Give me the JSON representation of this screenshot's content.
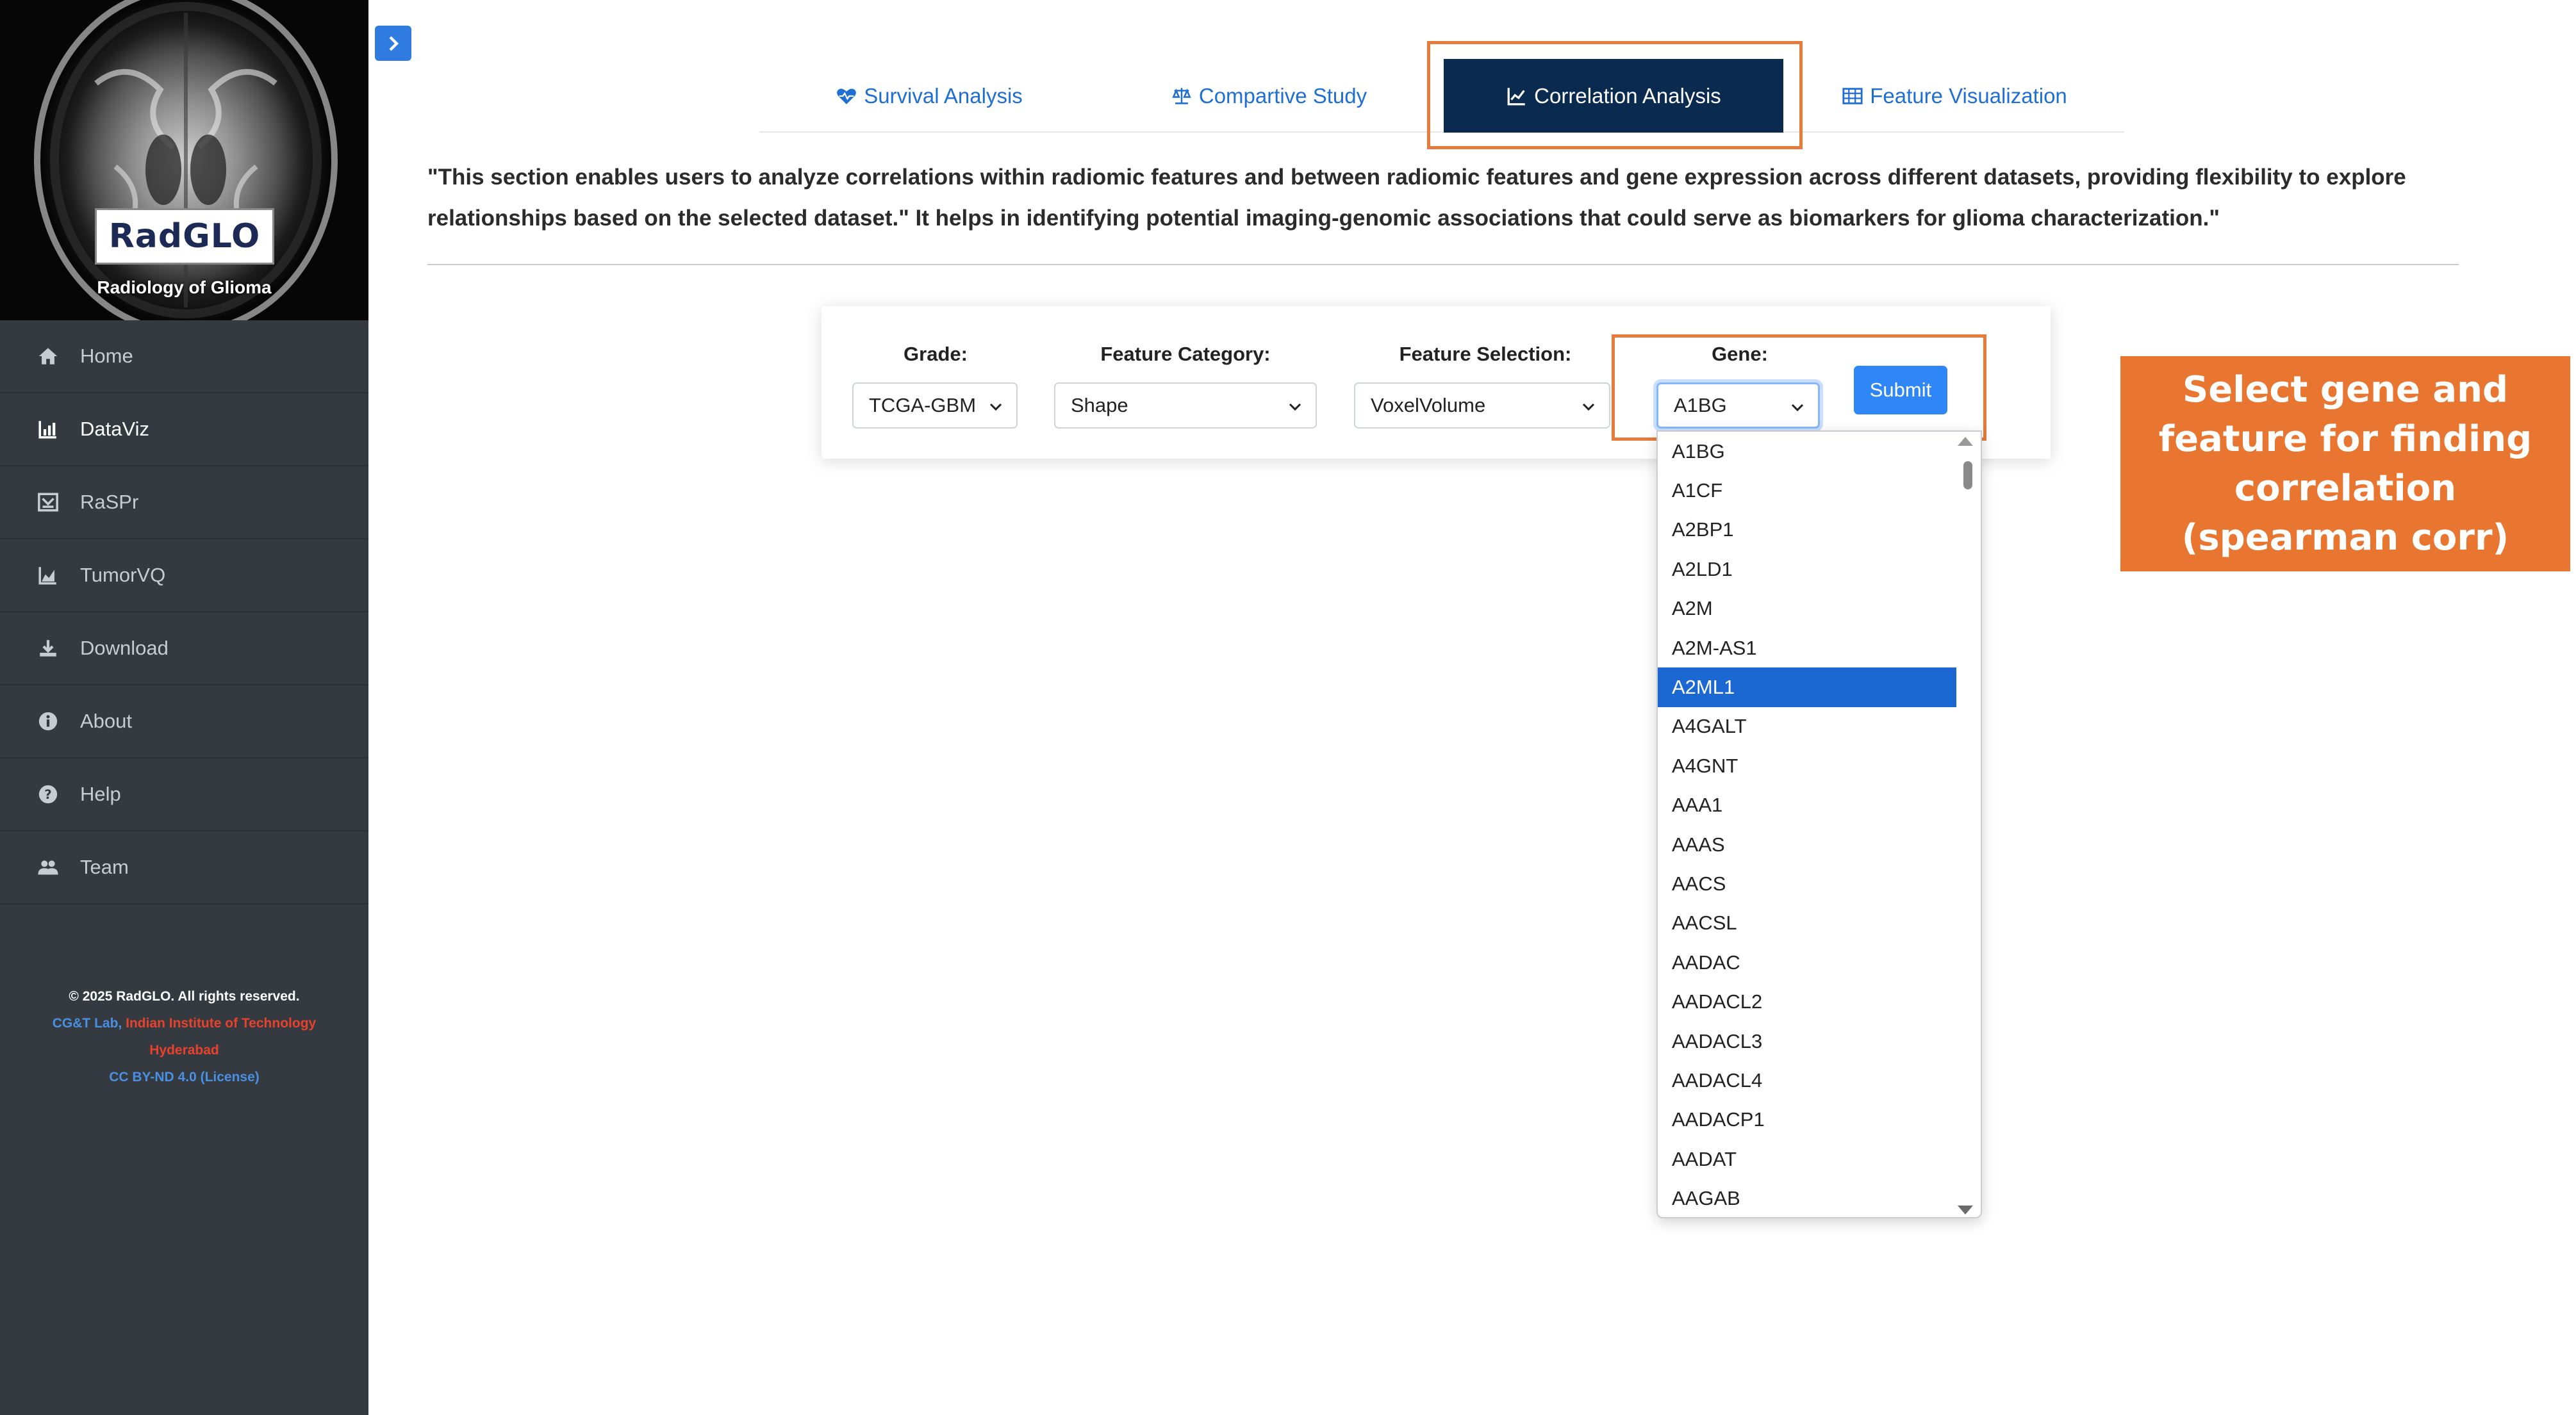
{
  "brand": {
    "title": "RadGLO",
    "subtitle": "Radiology of Glioma"
  },
  "sidebar": {
    "items": [
      {
        "label": "Home",
        "icon": "home-icon",
        "active": false
      },
      {
        "label": "DataViz",
        "icon": "bar-chart-icon",
        "active": true
      },
      {
        "label": "RaSPr",
        "icon": "network-icon",
        "active": false
      },
      {
        "label": "TumorVQ",
        "icon": "area-chart-icon",
        "active": false
      },
      {
        "label": "Download",
        "icon": "download-icon",
        "active": false
      },
      {
        "label": "About",
        "icon": "info-icon",
        "active": false
      },
      {
        "label": "Help",
        "icon": "question-icon",
        "active": false
      },
      {
        "label": "Team",
        "icon": "users-icon",
        "active": false
      }
    ],
    "footer": {
      "copyright": "© 2025 RadGLO. All rights reserved.",
      "lab": "CG&T Lab,",
      "institute_line1": "Indian Institute of Technology",
      "institute_line2": "Hyderabad",
      "license": "CC BY-ND 4.0 (License)"
    }
  },
  "tabs": [
    {
      "label": "Survival Analysis",
      "icon": "heartbeat-icon",
      "active": false
    },
    {
      "label": "Compartive Study",
      "icon": "balance-scale-icon",
      "active": false
    },
    {
      "label": "Correlation Analysis",
      "icon": "line-chart-icon",
      "active": true
    },
    {
      "label": "Feature Visualization",
      "icon": "table-icon",
      "active": false
    }
  ],
  "description": "\"This section enables users to analyze correlations within radiomic features and between radiomic features and gene expression across different datasets, providing flexibility to explore relationships based on the selected dataset.\" It helps in identifying potential imaging-genomic associations that could serve as biomarkers for glioma characterization.\"",
  "form": {
    "grade": {
      "label": "Grade:",
      "value": "TCGA-GBM"
    },
    "feature_category": {
      "label": "Feature Category:",
      "value": "Shape"
    },
    "feature_selection": {
      "label": "Feature Selection:",
      "value": "VoxelVolume"
    },
    "gene": {
      "label": "Gene:",
      "value": "A1BG"
    },
    "submit_label": "Submit"
  },
  "gene_options": [
    "A1BG",
    "A1CF",
    "A2BP1",
    "A2LD1",
    "A2M",
    "A2M-AS1",
    "A2ML1",
    "A4GALT",
    "A4GNT",
    "AAA1",
    "AAAS",
    "AACS",
    "AACSL",
    "AADAC",
    "AADACL2",
    "AADACL3",
    "AADACL4",
    "AADACP1",
    "AADAT",
    "AAGAB"
  ],
  "gene_highlighted": "A2ML1",
  "annotation": "Select gene and feature for finding correlation (spearman corr)",
  "colors": {
    "sidebar_bg": "#343a40",
    "accent_blue": "#1f6ed4",
    "active_tab_bg": "#0b2a4f",
    "highlight_orange": "#e87b3c",
    "selected_option_bg": "#1c68d3"
  }
}
